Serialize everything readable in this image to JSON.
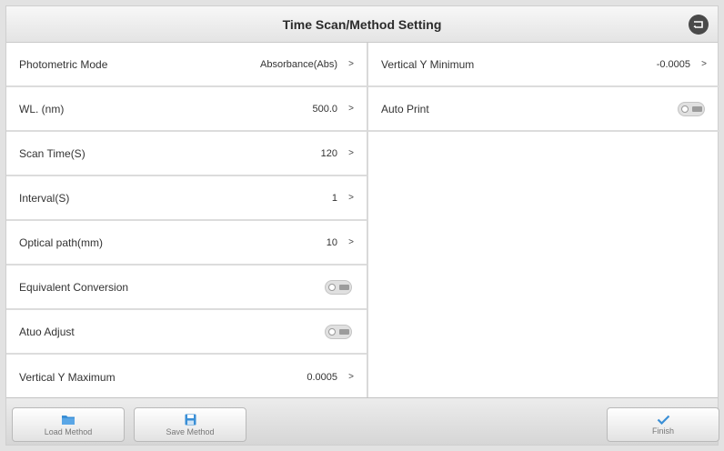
{
  "header": {
    "title": "Time Scan/Method Setting",
    "back_icon": "back-icon"
  },
  "left_settings": [
    {
      "label": "Photometric Mode",
      "value": "Absorbance(Abs)",
      "type": "select"
    },
    {
      "label": "WL. (nm)",
      "value": "500.0",
      "type": "select"
    },
    {
      "label": "Scan Time(S)",
      "value": "120",
      "type": "select"
    },
    {
      "label": "Interval(S)",
      "value": "1",
      "type": "select"
    },
    {
      "label": "Optical path(mm)",
      "value": "10",
      "type": "select"
    },
    {
      "label": "Equivalent Conversion",
      "type": "toggle",
      "state": "off"
    },
    {
      "label": "Atuo Adjust",
      "type": "toggle",
      "state": "off"
    },
    {
      "label": "Vertical Y Maximum",
      "value": "0.0005",
      "type": "select"
    }
  ],
  "right_settings": [
    {
      "label": "Vertical Y Minimum",
      "value": "-0.0005",
      "type": "select"
    },
    {
      "label": "Auto Print",
      "type": "toggle",
      "state": "off"
    }
  ],
  "chevron_glyph": ">",
  "footer": {
    "load_label": "Load Method",
    "save_label": "Save Method",
    "finish_label": "Finish"
  },
  "colors": {
    "accent_blue": "#3a8fd6",
    "text_dark": "#333333"
  }
}
